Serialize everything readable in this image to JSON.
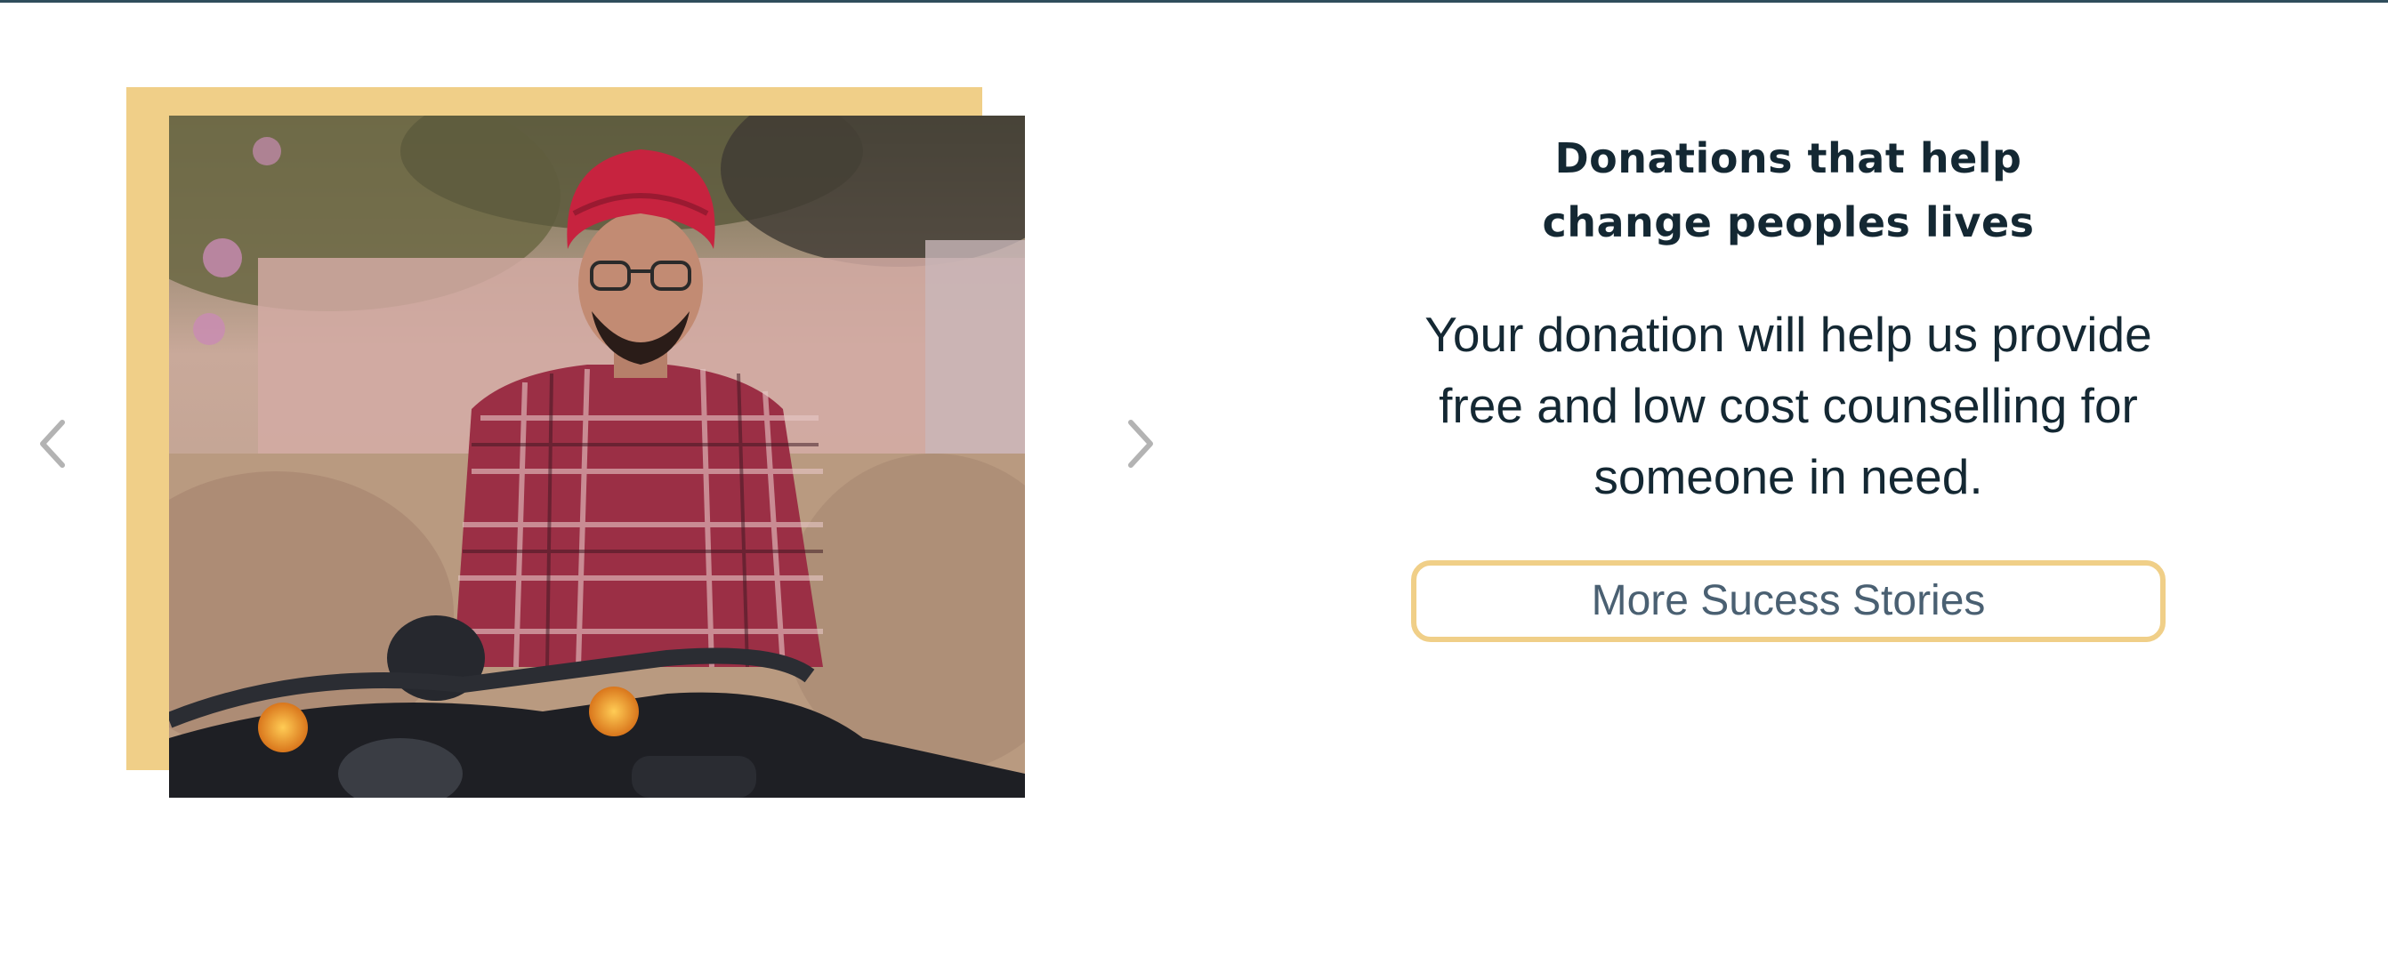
{
  "carousel": {
    "photo_alt": "Young man wearing a red turban and plaid shirt standing behind a motorcycle",
    "prev_icon": "chevron-left-icon",
    "next_icon": "chevron-right-icon"
  },
  "story": {
    "heading": "Donations that help change peoples lives",
    "text": "Your donation will help us provide free and low cost counselling for someone in need.",
    "button_label": "More Sucess Stories"
  },
  "colors": {
    "accent": "#f0cf88",
    "heading": "#142833",
    "button_text": "#4a6072",
    "top_border": "#2f4d5c",
    "arrow": "#b3b3b3"
  }
}
